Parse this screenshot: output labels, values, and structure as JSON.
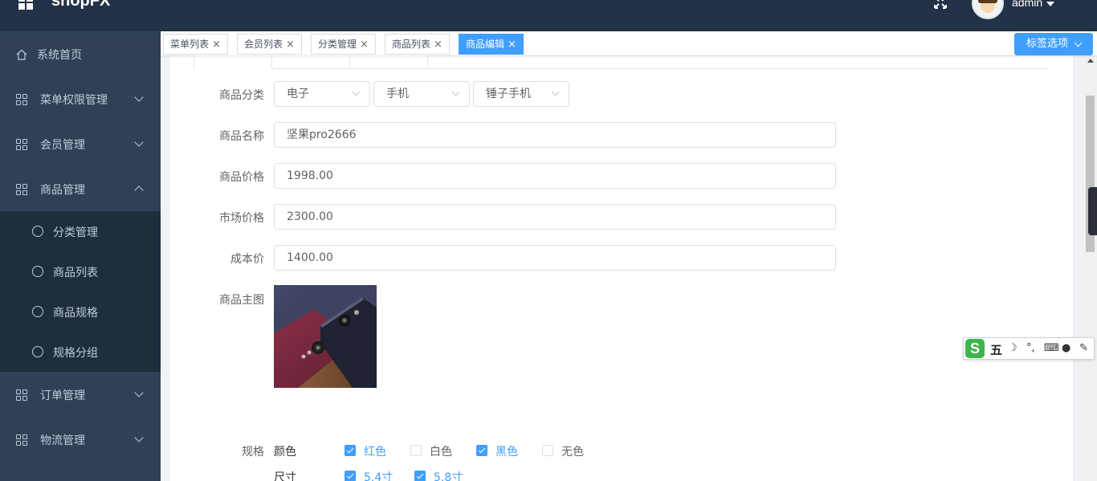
{
  "header": {
    "brand": "shopFX",
    "user": "admin"
  },
  "sidebar": {
    "items": [
      {
        "label": "系统首页"
      },
      {
        "label": "菜单权限管理"
      },
      {
        "label": "会员管理"
      },
      {
        "label": "商品管理"
      },
      {
        "label": "订单管理"
      },
      {
        "label": "物流管理"
      }
    ],
    "sub_items": [
      {
        "label": "分类管理"
      },
      {
        "label": "商品列表"
      },
      {
        "label": "商品规格"
      },
      {
        "label": "规格分组"
      }
    ]
  },
  "tabs": {
    "items": [
      {
        "label": "菜单列表",
        "close": "×"
      },
      {
        "label": "会员列表",
        "close": "×"
      },
      {
        "label": "分类管理",
        "close": "×"
      },
      {
        "label": "商品列表",
        "close": "×"
      },
      {
        "label": "商品编辑",
        "close": "×",
        "active": true
      }
    ],
    "options_label": "标签选项"
  },
  "form": {
    "category_label": "商品分类",
    "categories": [
      "电子",
      "手机",
      "锤子手机"
    ],
    "name_label": "商品名称",
    "name_value": "坚果pro2666",
    "price_label": "商品价格",
    "price_value": "1998.00",
    "market_price_label": "市场价格",
    "market_price_value": "2300.00",
    "cost_label": "成本价",
    "cost_value": "1400.00",
    "image_label": "商品主图",
    "spec_label": "规格",
    "specs": [
      {
        "name": "颜色",
        "options": [
          {
            "label": "红色",
            "checked": true
          },
          {
            "label": "白色",
            "checked": false
          },
          {
            "label": "黑色",
            "checked": true
          },
          {
            "label": "无色",
            "checked": false
          }
        ]
      },
      {
        "name": "尺寸",
        "options": [
          {
            "label": "5.4寸",
            "checked": true
          },
          {
            "label": "5.8寸",
            "checked": true
          }
        ]
      }
    ]
  },
  "ime": {
    "mode_label": "五",
    "logo": "S"
  },
  "colors": {
    "header_bg": "#243247",
    "sidebar_bg": "#304156",
    "accent": "#409eff"
  }
}
